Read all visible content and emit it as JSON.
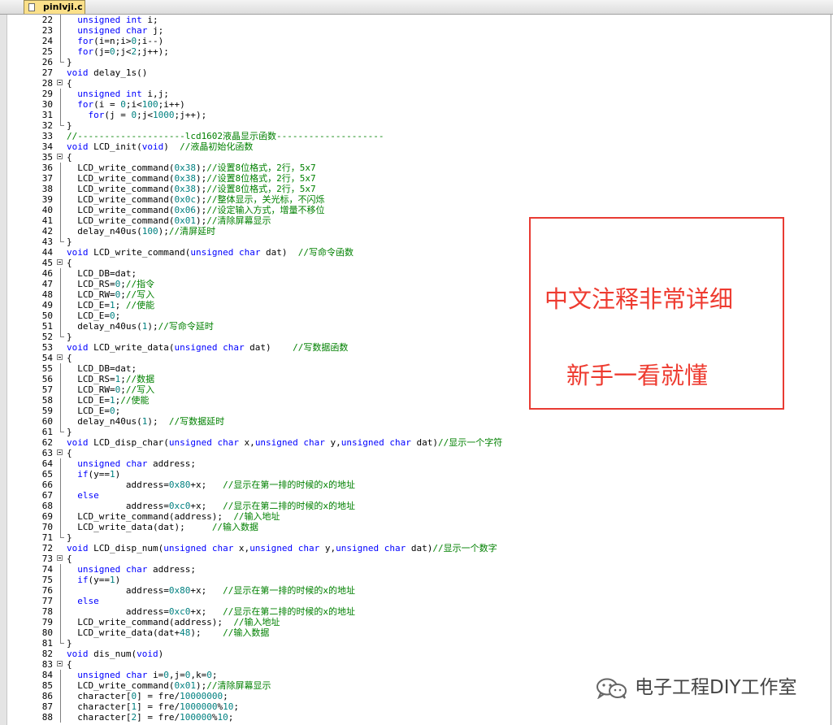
{
  "tab": {
    "filename": "pinlvji.c"
  },
  "code_lines": [
    {
      "n": "22",
      "fold": "mid",
      "parts": [
        [
          "p",
          "  "
        ],
        [
          "kw",
          "unsigned int"
        ],
        [
          "p",
          " i;"
        ]
      ]
    },
    {
      "n": "23",
      "fold": "mid",
      "parts": [
        [
          "p",
          "  "
        ],
        [
          "kw",
          "unsigned char"
        ],
        [
          "p",
          " j;"
        ]
      ]
    },
    {
      "n": "24",
      "fold": "mid",
      "parts": [
        [
          "p",
          "  "
        ],
        [
          "kw",
          "for"
        ],
        [
          "p",
          "(i=n;i>"
        ],
        [
          "nm",
          "0"
        ],
        [
          "p",
          ";i--)"
        ]
      ]
    },
    {
      "n": "25",
      "fold": "mid",
      "parts": [
        [
          "p",
          "  "
        ],
        [
          "kw",
          "for"
        ],
        [
          "p",
          "(j="
        ],
        [
          "nm",
          "0"
        ],
        [
          "p",
          ";j<"
        ],
        [
          "nm",
          "2"
        ],
        [
          "p",
          ";j++);"
        ]
      ]
    },
    {
      "n": "26",
      "fold": "end",
      "parts": [
        [
          "p",
          "}"
        ]
      ]
    },
    {
      "n": "27",
      "fold": "",
      "parts": [
        [
          "kw",
          "void"
        ],
        [
          "p",
          " delay_1s()"
        ]
      ]
    },
    {
      "n": "28",
      "fold": "box",
      "parts": [
        [
          "p",
          "{"
        ]
      ]
    },
    {
      "n": "29",
      "fold": "mid",
      "parts": [
        [
          "p",
          "  "
        ],
        [
          "kw",
          "unsigned int"
        ],
        [
          "p",
          " i,j;"
        ]
      ]
    },
    {
      "n": "30",
      "fold": "mid",
      "parts": [
        [
          "p",
          "  "
        ],
        [
          "kw",
          "for"
        ],
        [
          "p",
          "(i = "
        ],
        [
          "nm",
          "0"
        ],
        [
          "p",
          ";i<"
        ],
        [
          "nm",
          "100"
        ],
        [
          "p",
          ";i++)"
        ]
      ]
    },
    {
      "n": "31",
      "fold": "mid",
      "parts": [
        [
          "p",
          "    "
        ],
        [
          "kw",
          "for"
        ],
        [
          "p",
          "(j = "
        ],
        [
          "nm",
          "0"
        ],
        [
          "p",
          ";j<"
        ],
        [
          "nm",
          "1000"
        ],
        [
          "p",
          ";j++);"
        ]
      ]
    },
    {
      "n": "32",
      "fold": "end",
      "parts": [
        [
          "p",
          "}"
        ]
      ]
    },
    {
      "n": "33",
      "fold": "",
      "parts": [
        [
          "cm",
          "//--------------------lcd1602液晶显示函数--------------------"
        ]
      ]
    },
    {
      "n": "34",
      "fold": "",
      "parts": [
        [
          "kw",
          "void"
        ],
        [
          "p",
          " LCD_init("
        ],
        [
          "kw",
          "void"
        ],
        [
          "p",
          ")  "
        ],
        [
          "cm",
          "//液晶初始化函数"
        ]
      ]
    },
    {
      "n": "35",
      "fold": "box",
      "parts": [
        [
          "p",
          "{"
        ]
      ]
    },
    {
      "n": "36",
      "fold": "mid",
      "parts": [
        [
          "p",
          "  LCD_write_command("
        ],
        [
          "nm",
          "0x38"
        ],
        [
          "p",
          ");"
        ],
        [
          "cm",
          "//设置8位格式，2行，5x7"
        ]
      ]
    },
    {
      "n": "37",
      "fold": "mid",
      "parts": [
        [
          "p",
          "  LCD_write_command("
        ],
        [
          "nm",
          "0x38"
        ],
        [
          "p",
          ");"
        ],
        [
          "cm",
          "//设置8位格式，2行，5x7"
        ]
      ]
    },
    {
      "n": "38",
      "fold": "mid",
      "parts": [
        [
          "p",
          "  LCD_write_command("
        ],
        [
          "nm",
          "0x38"
        ],
        [
          "p",
          ");"
        ],
        [
          "cm",
          "//设置8位格式，2行，5x7"
        ]
      ]
    },
    {
      "n": "39",
      "fold": "mid",
      "parts": [
        [
          "p",
          "  LCD_write_command("
        ],
        [
          "nm",
          "0x0c"
        ],
        [
          "p",
          ");"
        ],
        [
          "cm",
          "//整体显示，关光标，不闪烁"
        ]
      ]
    },
    {
      "n": "40",
      "fold": "mid",
      "parts": [
        [
          "p",
          "  LCD_write_command("
        ],
        [
          "nm",
          "0x06"
        ],
        [
          "p",
          ");"
        ],
        [
          "cm",
          "//设定输入方式，增量不移位"
        ]
      ]
    },
    {
      "n": "41",
      "fold": "mid",
      "parts": [
        [
          "p",
          "  LCD_write_command("
        ],
        [
          "nm",
          "0x01"
        ],
        [
          "p",
          ");"
        ],
        [
          "cm",
          "//清除屏幕显示"
        ]
      ]
    },
    {
      "n": "42",
      "fold": "mid",
      "parts": [
        [
          "p",
          "  delay_n40us("
        ],
        [
          "nm",
          "100"
        ],
        [
          "p",
          ");"
        ],
        [
          "cm",
          "//清屏延时"
        ]
      ]
    },
    {
      "n": "43",
      "fold": "end",
      "parts": [
        [
          "p",
          "}"
        ]
      ]
    },
    {
      "n": "44",
      "fold": "",
      "parts": [
        [
          "kw",
          "void"
        ],
        [
          "p",
          " LCD_write_command("
        ],
        [
          "kw",
          "unsigned char"
        ],
        [
          "p",
          " dat)  "
        ],
        [
          "cm",
          "//写命令函数"
        ]
      ]
    },
    {
      "n": "45",
      "fold": "box",
      "parts": [
        [
          "p",
          "{"
        ]
      ]
    },
    {
      "n": "46",
      "fold": "mid",
      "parts": [
        [
          "p",
          "  LCD_DB=dat;"
        ]
      ]
    },
    {
      "n": "47",
      "fold": "mid",
      "parts": [
        [
          "p",
          "  LCD_RS="
        ],
        [
          "nm",
          "0"
        ],
        [
          "p",
          ";"
        ],
        [
          "cm",
          "//指令"
        ]
      ]
    },
    {
      "n": "48",
      "fold": "mid",
      "parts": [
        [
          "p",
          "  LCD_RW="
        ],
        [
          "nm",
          "0"
        ],
        [
          "p",
          ";"
        ],
        [
          "cm",
          "//写入"
        ]
      ]
    },
    {
      "n": "49",
      "fold": "mid",
      "parts": [
        [
          "p",
          "  LCD_E="
        ],
        [
          "nm",
          "1"
        ],
        [
          "p",
          "; "
        ],
        [
          "cm",
          "//使能"
        ]
      ]
    },
    {
      "n": "50",
      "fold": "mid",
      "parts": [
        [
          "p",
          "  LCD_E="
        ],
        [
          "nm",
          "0"
        ],
        [
          "p",
          ";"
        ]
      ]
    },
    {
      "n": "51",
      "fold": "mid",
      "parts": [
        [
          "p",
          "  delay_n40us("
        ],
        [
          "nm",
          "1"
        ],
        [
          "p",
          ");"
        ],
        [
          "cm",
          "//写命令延时"
        ]
      ]
    },
    {
      "n": "52",
      "fold": "end",
      "parts": [
        [
          "p",
          "}"
        ]
      ]
    },
    {
      "n": "53",
      "fold": "",
      "parts": [
        [
          "kw",
          "void"
        ],
        [
          "p",
          " LCD_write_data("
        ],
        [
          "kw",
          "unsigned char"
        ],
        [
          "p",
          " dat)    "
        ],
        [
          "cm",
          "//写数据函数"
        ]
      ]
    },
    {
      "n": "54",
      "fold": "box",
      "parts": [
        [
          "p",
          "{"
        ]
      ]
    },
    {
      "n": "55",
      "fold": "mid",
      "parts": [
        [
          "p",
          "  LCD_DB=dat;"
        ]
      ]
    },
    {
      "n": "56",
      "fold": "mid",
      "parts": [
        [
          "p",
          "  LCD_RS="
        ],
        [
          "nm",
          "1"
        ],
        [
          "p",
          ";"
        ],
        [
          "cm",
          "//数据"
        ]
      ]
    },
    {
      "n": "57",
      "fold": "mid",
      "parts": [
        [
          "p",
          "  LCD_RW="
        ],
        [
          "nm",
          "0"
        ],
        [
          "p",
          ";"
        ],
        [
          "cm",
          "//写入"
        ]
      ]
    },
    {
      "n": "58",
      "fold": "mid",
      "parts": [
        [
          "p",
          "  LCD_E="
        ],
        [
          "nm",
          "1"
        ],
        [
          "p",
          ";"
        ],
        [
          "cm",
          "//使能"
        ]
      ]
    },
    {
      "n": "59",
      "fold": "mid",
      "parts": [
        [
          "p",
          "  LCD_E="
        ],
        [
          "nm",
          "0"
        ],
        [
          "p",
          ";"
        ]
      ]
    },
    {
      "n": "60",
      "fold": "mid",
      "parts": [
        [
          "p",
          "  delay_n40us("
        ],
        [
          "nm",
          "1"
        ],
        [
          "p",
          ");  "
        ],
        [
          "cm",
          "//写数据延时"
        ]
      ]
    },
    {
      "n": "61",
      "fold": "end",
      "parts": [
        [
          "p",
          "}"
        ]
      ]
    },
    {
      "n": "62",
      "fold": "",
      "parts": [
        [
          "kw",
          "void"
        ],
        [
          "p",
          " LCD_disp_char("
        ],
        [
          "kw",
          "unsigned char"
        ],
        [
          "p",
          " x,"
        ],
        [
          "kw",
          "unsigned char"
        ],
        [
          "p",
          " y,"
        ],
        [
          "kw",
          "unsigned char"
        ],
        [
          "p",
          " dat)"
        ],
        [
          "cm",
          "//显示一个字符"
        ]
      ]
    },
    {
      "n": "63",
      "fold": "box",
      "parts": [
        [
          "p",
          "{"
        ]
      ]
    },
    {
      "n": "64",
      "fold": "mid",
      "parts": [
        [
          "p",
          "  "
        ],
        [
          "kw",
          "unsigned char"
        ],
        [
          "p",
          " address;"
        ]
      ]
    },
    {
      "n": "65",
      "fold": "mid",
      "parts": [
        [
          "p",
          "  "
        ],
        [
          "kw",
          "if"
        ],
        [
          "p",
          "(y=="
        ],
        [
          "nm",
          "1"
        ],
        [
          "p",
          ")"
        ]
      ]
    },
    {
      "n": "66",
      "fold": "mid",
      "parts": [
        [
          "p",
          "           address="
        ],
        [
          "nm",
          "0x80"
        ],
        [
          "p",
          "+x;   "
        ],
        [
          "cm",
          "//显示在第一排的时候的x的地址"
        ]
      ]
    },
    {
      "n": "67",
      "fold": "mid",
      "parts": [
        [
          "p",
          "  "
        ],
        [
          "kw",
          "else"
        ]
      ]
    },
    {
      "n": "68",
      "fold": "mid",
      "parts": [
        [
          "p",
          "           address="
        ],
        [
          "nm",
          "0xc0"
        ],
        [
          "p",
          "+x;   "
        ],
        [
          "cm",
          "//显示在第二排的时候的x的地址"
        ]
      ]
    },
    {
      "n": "69",
      "fold": "mid",
      "parts": [
        [
          "p",
          "  LCD_write_command(address);  "
        ],
        [
          "cm",
          "//输入地址"
        ]
      ]
    },
    {
      "n": "70",
      "fold": "mid",
      "parts": [
        [
          "p",
          "  LCD_write_data(dat);     "
        ],
        [
          "cm",
          "//输入数据"
        ]
      ]
    },
    {
      "n": "71",
      "fold": "end",
      "parts": [
        [
          "p",
          "}"
        ]
      ]
    },
    {
      "n": "72",
      "fold": "",
      "parts": [
        [
          "kw",
          "void"
        ],
        [
          "p",
          " LCD_disp_num("
        ],
        [
          "kw",
          "unsigned char"
        ],
        [
          "p",
          " x,"
        ],
        [
          "kw",
          "unsigned char"
        ],
        [
          "p",
          " y,"
        ],
        [
          "kw",
          "unsigned char"
        ],
        [
          "p",
          " dat)"
        ],
        [
          "cm",
          "//显示一个数字"
        ]
      ]
    },
    {
      "n": "73",
      "fold": "box",
      "parts": [
        [
          "p",
          "{"
        ]
      ]
    },
    {
      "n": "74",
      "fold": "mid",
      "parts": [
        [
          "p",
          "  "
        ],
        [
          "kw",
          "unsigned char"
        ],
        [
          "p",
          " address;"
        ]
      ]
    },
    {
      "n": "75",
      "fold": "mid",
      "parts": [
        [
          "p",
          "  "
        ],
        [
          "kw",
          "if"
        ],
        [
          "p",
          "(y=="
        ],
        [
          "nm",
          "1"
        ],
        [
          "p",
          ")"
        ]
      ]
    },
    {
      "n": "76",
      "fold": "mid",
      "parts": [
        [
          "p",
          "           address="
        ],
        [
          "nm",
          "0x80"
        ],
        [
          "p",
          "+x;   "
        ],
        [
          "cm",
          "//显示在第一排的时候的x的地址"
        ]
      ]
    },
    {
      "n": "77",
      "fold": "mid",
      "parts": [
        [
          "p",
          "  "
        ],
        [
          "kw",
          "else"
        ]
      ]
    },
    {
      "n": "78",
      "fold": "mid",
      "parts": [
        [
          "p",
          "           address="
        ],
        [
          "nm",
          "0xc0"
        ],
        [
          "p",
          "+x;   "
        ],
        [
          "cm",
          "//显示在第二排的时候的x的地址"
        ]
      ]
    },
    {
      "n": "79",
      "fold": "mid",
      "parts": [
        [
          "p",
          "  LCD_write_command(address);  "
        ],
        [
          "cm",
          "//输入地址"
        ]
      ]
    },
    {
      "n": "80",
      "fold": "mid",
      "parts": [
        [
          "p",
          "  LCD_write_data(dat+"
        ],
        [
          "nm",
          "48"
        ],
        [
          "p",
          ");    "
        ],
        [
          "cm",
          "//输入数据"
        ]
      ]
    },
    {
      "n": "81",
      "fold": "end",
      "parts": [
        [
          "p",
          "}"
        ]
      ]
    },
    {
      "n": "82",
      "fold": "",
      "parts": [
        [
          "kw",
          "void"
        ],
        [
          "p",
          " dis_num("
        ],
        [
          "kw",
          "void"
        ],
        [
          "p",
          ")"
        ]
      ]
    },
    {
      "n": "83",
      "fold": "box",
      "parts": [
        [
          "p",
          "{"
        ]
      ]
    },
    {
      "n": "84",
      "fold": "mid",
      "parts": [
        [
          "p",
          "  "
        ],
        [
          "kw",
          "unsigned char"
        ],
        [
          "p",
          " i="
        ],
        [
          "nm",
          "0"
        ],
        [
          "p",
          ",j="
        ],
        [
          "nm",
          "0"
        ],
        [
          "p",
          ",k="
        ],
        [
          "nm",
          "0"
        ],
        [
          "p",
          ";"
        ]
      ]
    },
    {
      "n": "85",
      "fold": "mid",
      "parts": [
        [
          "p",
          "  LCD_write_command("
        ],
        [
          "nm",
          "0x01"
        ],
        [
          "p",
          ");"
        ],
        [
          "cm",
          "//清除屏幕显示"
        ]
      ]
    },
    {
      "n": "86",
      "fold": "mid",
      "parts": [
        [
          "p",
          "  character["
        ],
        [
          "nm",
          "0"
        ],
        [
          "p",
          "] = fre/"
        ],
        [
          "nm",
          "10000000"
        ],
        [
          "p",
          ";"
        ]
      ]
    },
    {
      "n": "87",
      "fold": "mid",
      "parts": [
        [
          "p",
          "  character["
        ],
        [
          "nm",
          "1"
        ],
        [
          "p",
          "] = fre/"
        ],
        [
          "nm",
          "1000000"
        ],
        [
          "p",
          "%"
        ],
        [
          "nm",
          "10"
        ],
        [
          "p",
          ";"
        ]
      ]
    },
    {
      "n": "88",
      "fold": "mid",
      "parts": [
        [
          "p",
          "  character["
        ],
        [
          "nm",
          "2"
        ],
        [
          "p",
          "] = fre/"
        ],
        [
          "nm",
          "100000"
        ],
        [
          "p",
          "%"
        ],
        [
          "nm",
          "10"
        ],
        [
          "p",
          ";"
        ]
      ]
    }
  ],
  "annotation": {
    "line1": "中文注释非常详细",
    "line2": "新手一看就懂"
  },
  "watermark": {
    "text": "电子工程DIY工作室"
  },
  "colors": {
    "keyword": "#0000ff",
    "number": "#008080",
    "comment": "#008000",
    "annotation": "#ee3b30",
    "tab": "#fbe08a"
  },
  "icons": {
    "tab": "c-file-icon",
    "watermark": "wechat-logo-icon"
  }
}
